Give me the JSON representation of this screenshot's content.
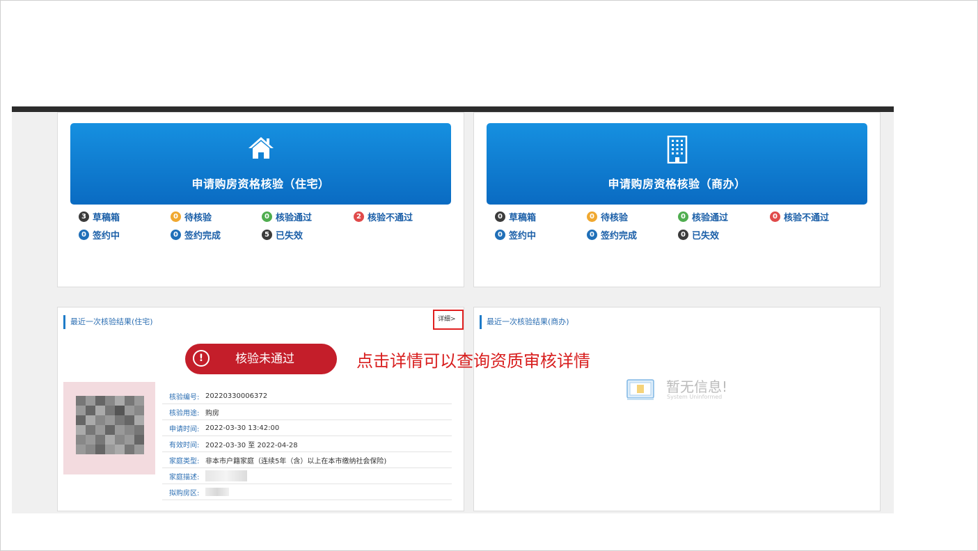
{
  "residential": {
    "banner_title": "申请购房资格核验（住宅）",
    "banner_icon": "house-icon",
    "stats": [
      {
        "count": "3",
        "label": "草稿箱",
        "color": "#3b3b3b"
      },
      {
        "count": "0",
        "label": "待核验",
        "color": "#f0a830"
      },
      {
        "count": "0",
        "label": "核验通过",
        "color": "#4fad4f"
      },
      {
        "count": "2",
        "label": "核验不通过",
        "color": "#e04a4a"
      },
      {
        "count": "0",
        "label": "签约中",
        "color": "#1f6fb8"
      },
      {
        "count": "0",
        "label": "签约完成",
        "color": "#1f6fb8"
      },
      {
        "count": "5",
        "label": "已失效",
        "color": "#3b3b3b"
      }
    ]
  },
  "commercial": {
    "banner_title": "申请购房资格核验（商办）",
    "banner_icon": "office-building-icon",
    "stats": [
      {
        "count": "0",
        "label": "草稿箱",
        "color": "#3b3b3b"
      },
      {
        "count": "0",
        "label": "待核验",
        "color": "#f0a830"
      },
      {
        "count": "0",
        "label": "核验通过",
        "color": "#4fad4f"
      },
      {
        "count": "0",
        "label": "核验不通过",
        "color": "#e04a4a"
      },
      {
        "count": "0",
        "label": "签约中",
        "color": "#1f6fb8"
      },
      {
        "count": "0",
        "label": "签约完成",
        "color": "#1f6fb8"
      },
      {
        "count": "0",
        "label": "已失效",
        "color": "#3b3b3b"
      }
    ]
  },
  "latest_residential": {
    "section_title": "最近一次核验结果(住宅)",
    "detail_link": "详细>",
    "status_button": "核验未通过",
    "fields": [
      {
        "label": "核验编号:",
        "value": "20220330006372"
      },
      {
        "label": "核验用途:",
        "value": "购房"
      },
      {
        "label": "申请时间:",
        "value": "2022-03-30 13:42:00"
      },
      {
        "label": "有效时间:",
        "value": "2022-03-30 至 2022-04-28"
      },
      {
        "label": "家庭类型:",
        "value": "非本市户籍家庭（连续5年（含）以上在本市缴纳社会保险)"
      },
      {
        "label": "家庭描述:",
        "value": ""
      },
      {
        "label": "拟购房区:",
        "value": ""
      }
    ]
  },
  "latest_commercial": {
    "section_title": "最近一次核验结果(商办)",
    "empty_title": "暂无信息!",
    "empty_subtitle": "System Uninformed"
  },
  "annotation": "点击详情可以查询资质审核详情",
  "colors": {
    "accent": "#0a6bc2",
    "fail": "#c41e2a",
    "annotation": "#d81e1e"
  }
}
